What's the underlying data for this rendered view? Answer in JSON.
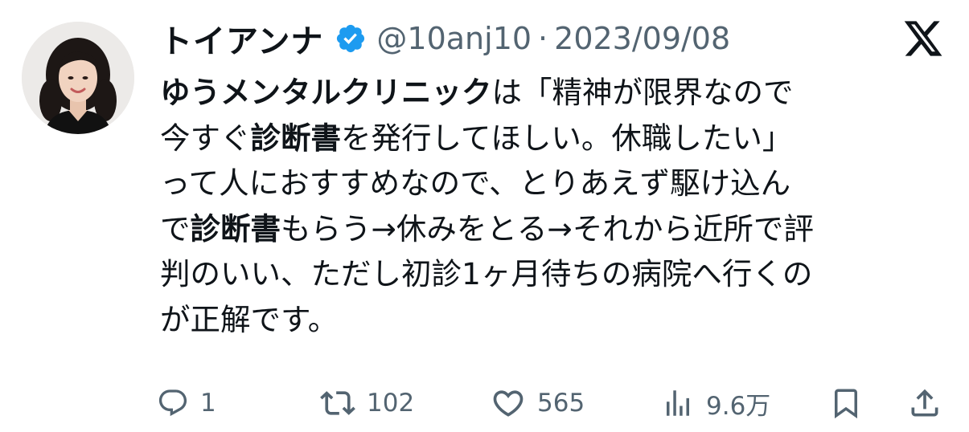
{
  "tweet": {
    "author_name": "トイアンナ",
    "author_handle": "@10anj10",
    "separator": "·",
    "date": "2023/09/08",
    "lines": [
      [
        {
          "t": "ゆうメンタルクリニック",
          "b": true
        },
        {
          "t": "は「精神が限界なので",
          "b": false
        }
      ],
      [
        {
          "t": "今すぐ",
          "b": false
        },
        {
          "t": "診断書",
          "b": true
        },
        {
          "t": "を発行してほしい。休職したい」",
          "b": false
        }
      ],
      [
        {
          "t": "って人におすすめなので、とりあえず駆け込ん",
          "b": false
        }
      ],
      [
        {
          "t": "で",
          "b": false
        },
        {
          "t": "診断書",
          "b": true
        },
        {
          "t": "もらう→休みをとる→それから近所で評",
          "b": false
        }
      ],
      [
        {
          "t": "判のいい、ただし初診1ヶ月待ちの病院へ行くの",
          "b": false
        }
      ],
      [
        {
          "t": "が正解です。",
          "b": false
        }
      ]
    ]
  },
  "actions": {
    "reply_count": "1",
    "retweet_count": "102",
    "like_count": "565",
    "views_count": "9.6万"
  },
  "icons": {
    "verified": "verified-badge-icon",
    "platform": "x-logo-icon",
    "reply": "reply-icon",
    "retweet": "retweet-icon",
    "like": "heart-icon",
    "views": "views-icon",
    "bookmark": "bookmark-icon",
    "share": "share-icon"
  },
  "colors": {
    "text": "#0f1419",
    "secondary": "#536471",
    "verified": "#1d9bf0"
  }
}
